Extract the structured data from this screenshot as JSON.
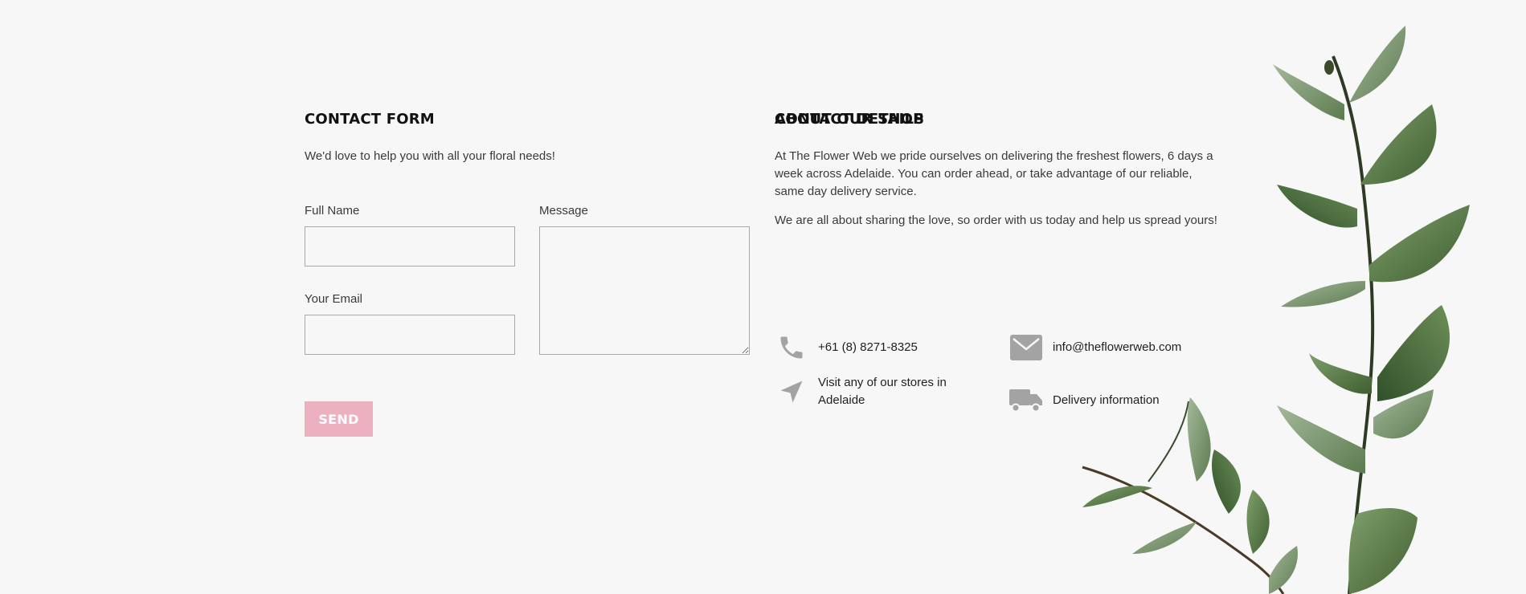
{
  "contact_form": {
    "title": "CONTACT FORM",
    "intro": "We'd love to help you with all your floral needs!",
    "full_name_label": "Full Name",
    "full_name_value": "",
    "email_label": "Your Email",
    "email_value": "",
    "message_label": "Message",
    "message_value": "",
    "send_label": "SEND"
  },
  "about": {
    "title": "ABOUT OUR SHOP",
    "paragraph_1": "At The Flower Web we pride ourselves on delivering the freshest flowers, 6 days a week across Adelaide. You can order ahead, or take advantage of our reliable, same day delivery service.",
    "paragraph_2": "We are all about sharing the love, so order with us today and help us spread yours!"
  },
  "contact_details": {
    "title": "CONTACT DETAILS",
    "phone": {
      "icon": "phone-icon",
      "text": "+61 (8) 8271-8325"
    },
    "email": {
      "icon": "envelope-icon",
      "text": "info@theflowerweb.com"
    },
    "stores": {
      "icon": "location-arrow-icon",
      "text": "Visit any of our stores in Adelaide"
    },
    "delivery": {
      "icon": "truck-icon",
      "text": "Delivery information"
    }
  },
  "colors": {
    "background": "#f7f7f8",
    "send_button": "#ecb0bf",
    "icon_gray": "#a3a3a3"
  }
}
